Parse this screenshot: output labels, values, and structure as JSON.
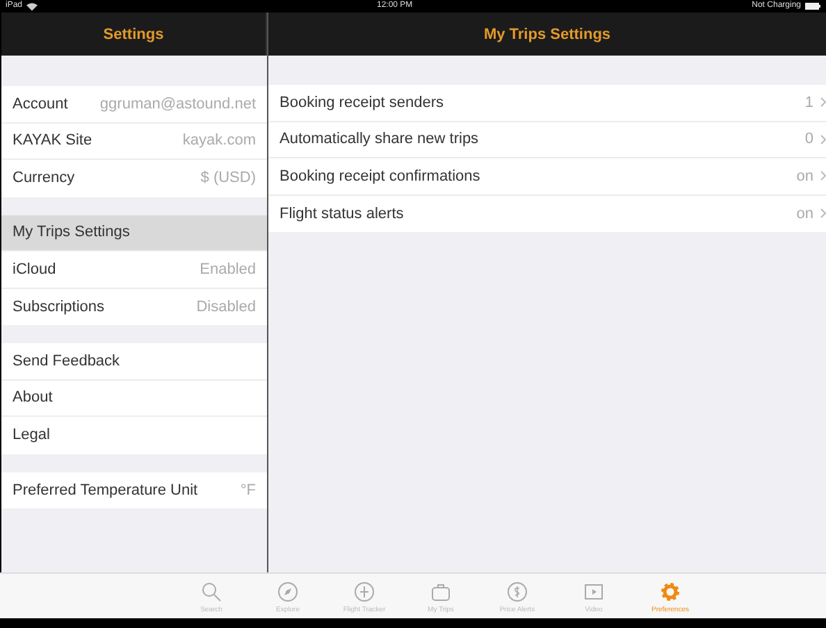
{
  "status_bar": {
    "device": "iPad",
    "time": "12:00 PM",
    "charging": "Not Charging"
  },
  "sidebar": {
    "title": "Settings",
    "groups": [
      [
        {
          "label": "Account",
          "value": "ggruman@astound.net",
          "selected": false
        },
        {
          "label": "KAYAK Site",
          "value": "kayak.com",
          "selected": false
        },
        {
          "label": "Currency",
          "value": "$ (USD)",
          "selected": false
        }
      ],
      [
        {
          "label": "My Trips Settings",
          "selected": true
        },
        {
          "label": "iCloud",
          "value": "Enabled",
          "selected": false
        },
        {
          "label": "Subscriptions",
          "value": "Disabled",
          "selected": false
        }
      ],
      [
        {
          "label": "Send Feedback",
          "selected": false
        },
        {
          "label": "About",
          "selected": false
        },
        {
          "label": "Legal",
          "selected": false
        }
      ],
      [
        {
          "label": "Preferred Temperature Unit",
          "value": "°F",
          "selected": false
        }
      ]
    ]
  },
  "detail": {
    "title": "My Trips Settings",
    "rows": [
      {
        "label": "Booking receipt senders",
        "value": "1"
      },
      {
        "label": "Automatically share new trips",
        "value": "0"
      },
      {
        "label": "Booking receipt confirmations",
        "value": "on"
      },
      {
        "label": "Flight status alerts",
        "value": "on"
      }
    ]
  },
  "tab_bar": [
    {
      "kind": "search",
      "label": "Search",
      "selected": false
    },
    {
      "kind": "explore",
      "label": "Explore",
      "selected": false
    },
    {
      "kind": "tracker",
      "label": "Flight Tracker",
      "selected": false
    },
    {
      "kind": "trips",
      "label": "My Trips",
      "selected": false
    },
    {
      "kind": "alerts",
      "label": "Price Alerts",
      "selected": false
    },
    {
      "kind": "video",
      "label": "Video",
      "selected": false
    },
    {
      "kind": "preferences",
      "label": "Preferences",
      "selected": true
    }
  ]
}
